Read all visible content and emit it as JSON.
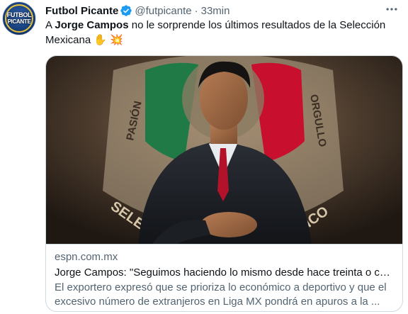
{
  "tweet": {
    "author": {
      "display_name": "Futbol Picante",
      "handle": "@futpicante",
      "avatar_line1": "FUTBOL",
      "avatar_line2": "PICANTE",
      "verified": true
    },
    "separator": "·",
    "time": "33min",
    "more_icon": "more-dots-icon",
    "text": {
      "prefix": "A ",
      "bold": "Jorge Campos",
      "suffix": " no le sorprende los últimos resultados de la Selección Mexicana ",
      "emoji_1": "✋",
      "emoji_2": "💥"
    }
  },
  "card": {
    "image_text": {
      "left_word": "PASIÓN",
      "right_word": "ORGULLO",
      "bottom_left": "SELE",
      "bottom_right": "XICO"
    },
    "domain": "espn.com.mx",
    "title": "Jorge Campos: \"Seguimos haciendo lo mismo desde hace treinta o cu...",
    "description": "El exportero expresó que se prioriza lo económico a deportivo y que el excesivo número de extranjeros en Liga MX pondrá en apuros a la ..."
  },
  "colors": {
    "text_primary": "#0f1419",
    "text_secondary": "#536471",
    "verified_blue": "#1d9bf0",
    "border": "#cfd9de",
    "flag_green": "#1f7a45",
    "flag_red": "#c8102e"
  }
}
